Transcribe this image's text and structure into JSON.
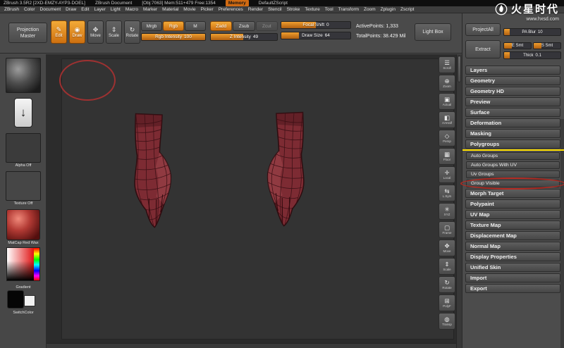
{
  "titlebar": {
    "app": "ZBrush 3.5R2 [2XD-EMZY-AYP3-DOEL]",
    "doc": "ZBrush Document",
    "stats": "[Obj:7063] Mem:511+479 Free:1354",
    "memory_badge": "Memory",
    "zscript": "DefaultZScript"
  },
  "menubar": {
    "items": [
      "ZBrush",
      "Color",
      "Document",
      "Draw",
      "Edit",
      "Layer",
      "Light",
      "Macro",
      "Marker",
      "Material",
      "Movie",
      "Picker",
      "Preferences",
      "Render",
      "Stencil",
      "Stroke",
      "Texture",
      "Tool",
      "Transform",
      "Zoom",
      "Zplugin",
      "Zscript"
    ]
  },
  "shelf": {
    "projection_master": "Projection Master",
    "modes": [
      {
        "label": "Edit",
        "glyph": "✎",
        "active": true
      },
      {
        "label": "Draw",
        "glyph": "◉",
        "active": true
      },
      {
        "label": "Move",
        "glyph": "✥",
        "active": false
      },
      {
        "label": "Scale",
        "glyph": "⇕",
        "active": false
      },
      {
        "label": "Rotate",
        "glyph": "↻",
        "active": false
      }
    ],
    "paint_modes": [
      {
        "label": "Mrgb",
        "active": false
      },
      {
        "label": "Rgb",
        "active": true
      },
      {
        "label": "M",
        "active": false
      }
    ],
    "sculpt_modes": [
      {
        "label": "Zadd",
        "active": true
      },
      {
        "label": "Zsub",
        "active": false
      },
      {
        "label": "Zcut",
        "active": false,
        "disabled": true
      }
    ],
    "sliders": {
      "rgb_intensity": {
        "label": "Rgb Intensity",
        "value": "100",
        "fill": 100
      },
      "z_intensity": {
        "label": "Z Intensity",
        "value": "49",
        "fill": 49
      },
      "focal_shift": {
        "label": "Focal Shift",
        "value": "0",
        "fill": 50
      },
      "draw_size": {
        "label": "Draw Size",
        "value": "64",
        "fill": 25
      }
    },
    "active_points": "ActivePoints: 1,333",
    "total_points": "TotalPoints: 38.429 Mil",
    "light_box": "Light Box"
  },
  "left_tray": {
    "stroke_glyph": "↓",
    "labels": {
      "alpha": "Alpha Off",
      "texture": "Texture Off",
      "material": "MatCap Red Wax",
      "gradient": "Gradient",
      "switch_color": "SwitchColor"
    }
  },
  "right_strip": {
    "items": [
      {
        "glyph": "☰",
        "label": "Scroll"
      },
      {
        "glyph": "⊕",
        "label": "Zoom"
      },
      {
        "glyph": "▣",
        "label": "Actual"
      },
      {
        "glyph": "◧",
        "label": "AAHalf"
      },
      {
        "glyph": "◇",
        "label": "Persp"
      },
      {
        "glyph": "▦",
        "label": "Floor"
      },
      {
        "glyph": "✛",
        "label": "Local"
      },
      {
        "glyph": "⇆",
        "label": "L.Sym"
      },
      {
        "glyph": "✳",
        "label": "XYZ"
      },
      {
        "glyph": "▢",
        "label": "Frame"
      },
      {
        "glyph": "✥",
        "label": "Move"
      },
      {
        "glyph": "⇕",
        "label": "Scale"
      },
      {
        "glyph": "↻",
        "label": "Rotate"
      },
      {
        "glyph": "⊞",
        "label": "PolyF"
      },
      {
        "glyph": "◍",
        "label": "Transp"
      }
    ]
  },
  "tool_panel": {
    "project_all": "ProjectAll",
    "pa_blur": {
      "label": "PA Blur",
      "value": "10",
      "fill": 10
    },
    "extract": "Extract",
    "e_smt": {
      "label": "E Smt",
      "fill": 30
    },
    "s_smt": {
      "label": "S Smt",
      "fill": 30
    },
    "thick": {
      "label": "Thick",
      "value": "0.1",
      "fill": 10
    },
    "sections": [
      {
        "label": "Layers",
        "type": "section"
      },
      {
        "label": "Geometry",
        "type": "section"
      },
      {
        "label": "Geometry HD",
        "type": "section"
      },
      {
        "label": "Preview",
        "type": "section"
      },
      {
        "label": "Surface",
        "type": "section"
      },
      {
        "label": "Deformation",
        "type": "section"
      },
      {
        "label": "Masking",
        "type": "section"
      },
      {
        "label": "Polygroups",
        "type": "section-open"
      },
      {
        "label": "Auto Groups",
        "type": "sub"
      },
      {
        "label": "Auto Groups With UV",
        "type": "sub"
      },
      {
        "label": "Uv Groups",
        "type": "sub"
      },
      {
        "label": "Group Visible",
        "type": "sub-circled"
      },
      {
        "label": "Morph Target",
        "type": "section"
      },
      {
        "label": "Polypaint",
        "type": "section"
      },
      {
        "label": "UV Map",
        "type": "section"
      },
      {
        "label": "Texture Map",
        "type": "section"
      },
      {
        "label": "Displacement Map",
        "type": "section"
      },
      {
        "label": "Normal Map",
        "type": "section"
      },
      {
        "label": "Display Properties",
        "type": "section"
      },
      {
        "label": "Unified Skin",
        "type": "section"
      },
      {
        "label": "Import",
        "type": "section"
      },
      {
        "label": "Export",
        "type": "section"
      }
    ]
  },
  "watermark": {
    "brand": "火星时代",
    "url": "www.hxsd.com"
  },
  "colors": {
    "accent_orange": "#d9751a",
    "highlight_yellow": "#ffe000",
    "annotation_red": "#b13131",
    "model_red": "#7d2b33",
    "canvas_gray": "#2c2c2c"
  }
}
